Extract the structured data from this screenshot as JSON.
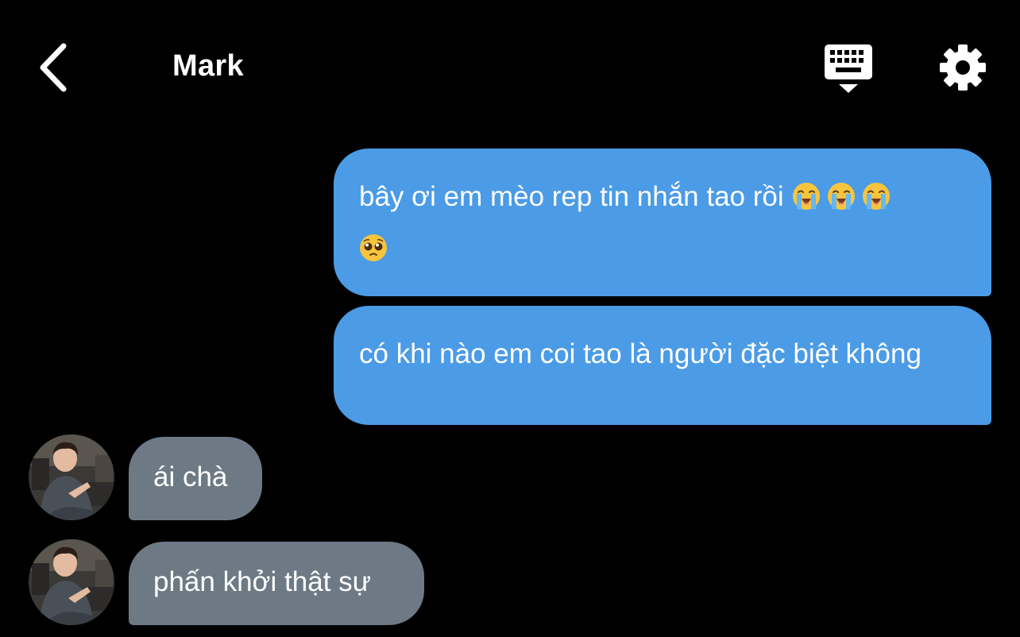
{
  "header": {
    "title": "Mark",
    "back_icon": "chevron-left-icon",
    "keyboard_icon": "keyboard-hide-icon",
    "settings_icon": "gear-icon"
  },
  "colors": {
    "background": "#000000",
    "outgoing_bubble": "#4b9be6",
    "incoming_bubble": "#6d7a86",
    "text": "#ffffff"
  },
  "messages": [
    {
      "direction": "outgoing",
      "text": "bây ơi em mèo rep tin nhắn tao rồi",
      "emojis": [
        "loudly-crying-face",
        "loudly-crying-face",
        "loudly-crying-face",
        "pleading-face"
      ]
    },
    {
      "direction": "outgoing",
      "text": "có khi nào em coi tao là người đặc biệt không"
    },
    {
      "direction": "incoming",
      "text": "ái chà",
      "avatar": "sender-avatar"
    },
    {
      "direction": "incoming",
      "text": "phấn khởi thật sự",
      "avatar": "sender-avatar"
    }
  ]
}
